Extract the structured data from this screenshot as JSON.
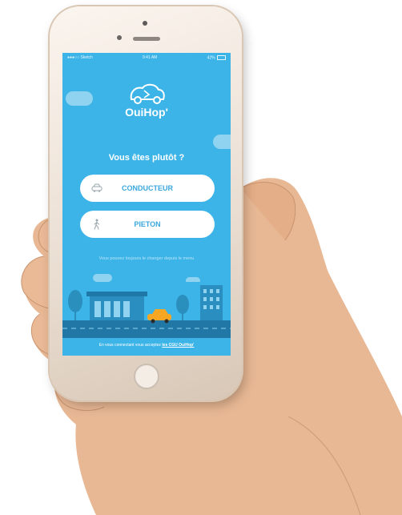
{
  "status_bar": {
    "carrier": "●●●○○ Sketch",
    "time": "9:41 AM",
    "battery": "42%"
  },
  "app": {
    "name": "OuiHop'",
    "question": "Vous êtes plutôt ?",
    "options": [
      {
        "label": "CONDUCTEUR",
        "icon": "car-icon"
      },
      {
        "label": "PIETON",
        "icon": "pedestrian-icon"
      }
    ],
    "hint": "Vous pouvez toujours le changer depuis le menu",
    "footer_prefix": "En vous connectant vous acceptez",
    "footer_link": "les CGU OuiHop'"
  },
  "colors": {
    "screen_bg": "#3db4e7",
    "button_text": "#3aa8df",
    "car": "#f5a623"
  }
}
